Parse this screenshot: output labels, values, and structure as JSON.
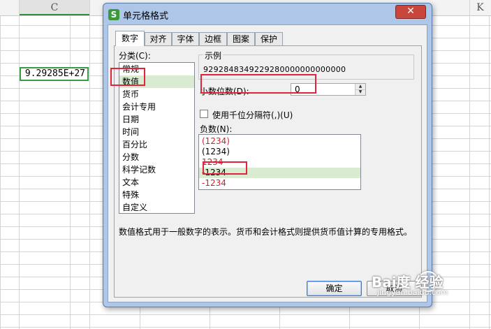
{
  "sheet": {
    "col_c": "C",
    "col_k": "K",
    "active_cell_value": "9.29285E+27"
  },
  "dialog": {
    "title": "单元格格式",
    "app_icon_letter": "S",
    "close_label": "✕",
    "tabs": [
      {
        "label": "数字",
        "active": true
      },
      {
        "label": "对齐"
      },
      {
        "label": "字体"
      },
      {
        "label": "边框"
      },
      {
        "label": "图案"
      },
      {
        "label": "保护"
      }
    ],
    "category_label": "分类(C):",
    "categories": [
      "常规",
      "数值",
      "货币",
      "会计专用",
      "日期",
      "时间",
      "百分比",
      "分数",
      "科学记数",
      "文本",
      "特殊",
      "自定义"
    ],
    "selected_category": "数值",
    "sample_title": "示例",
    "sample_value": "9292848349229280000000000000",
    "decimal_label": "小数位数(D):",
    "decimal_value": "0",
    "thousands_label": "使用千位分隔符(,)(U)",
    "thousands_checked": false,
    "negative_label": "负数(N):",
    "negative_options": [
      {
        "text": "(1234)",
        "color": "#d0202e"
      },
      {
        "text": "(1234)",
        "color": "#000000"
      },
      {
        "text": "1234",
        "color": "#d0202e"
      },
      {
        "text": "-1234",
        "color": "#000000",
        "selected": true
      },
      {
        "text": "-1234",
        "color": "#d0202e"
      }
    ],
    "description": "数值格式用于一般数字的表示。货币和会计格式则提供货币值计算的专用格式。",
    "ok_label": "确定",
    "cancel_label": "取消"
  },
  "watermark": {
    "text": "Bai度 经验",
    "url": "jingyan.baidu.com"
  },
  "colors": {
    "accent_green": "#3b9c46",
    "highlight_red": "#e0243a",
    "selection_green": "#d9ecd1"
  }
}
